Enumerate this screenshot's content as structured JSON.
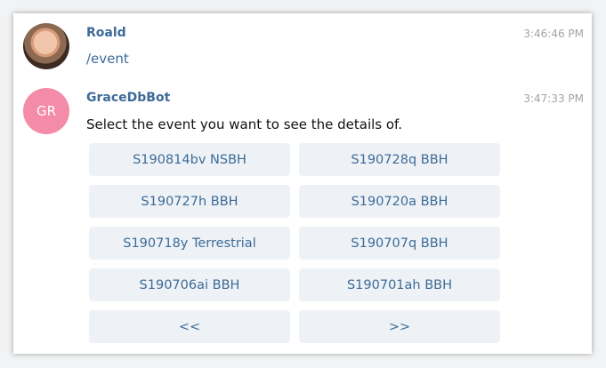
{
  "messages": [
    {
      "sender": "Roald",
      "time": "3:46:46 PM",
      "text": "/event",
      "avatar": {
        "type": "photo"
      }
    },
    {
      "sender": "GraceDbBot",
      "time": "3:47:33 PM",
      "text": "Select the event you want to see the details of.",
      "avatar": {
        "type": "initials",
        "initials": "GR",
        "color": "#f48ba9"
      }
    }
  ],
  "keyboard": {
    "buttons": [
      "S190814bv NSBH",
      "S190728q BBH",
      "S190727h BBH",
      "S190720a BBH",
      "S190718y Terrestrial",
      "S190707q BBH",
      "S190706ai BBH",
      "S190701ah BBH",
      "<<",
      ">>"
    ]
  },
  "colors": {
    "link": "#3d6b98",
    "button_bg": "#eef2f6",
    "timestamp": "#a3a3a3",
    "bot_avatar": "#f48ba9"
  }
}
